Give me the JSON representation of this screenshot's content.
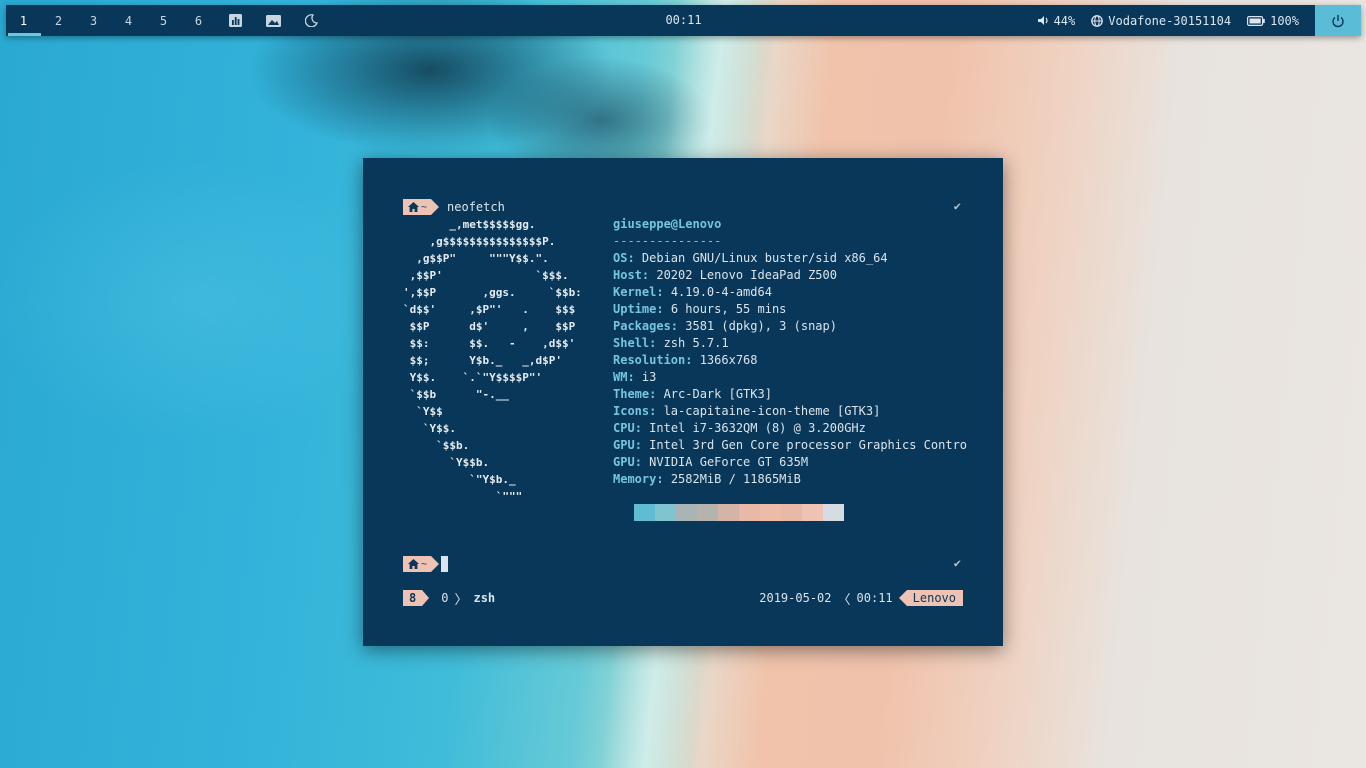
{
  "topbar": {
    "workspaces": [
      "1",
      "2",
      "3",
      "4",
      "5",
      "6"
    ],
    "active_workspace": "1",
    "clock": "00:11",
    "volume": "44%",
    "network": "Vodafone-30151104",
    "battery": "100%",
    "icons": [
      "chart-icon",
      "image-icon",
      "moon-icon",
      "volume-icon",
      "globe-icon",
      "battery-icon",
      "power-icon"
    ]
  },
  "terminal": {
    "home_glyph": "~",
    "command": "neofetch",
    "ascii_art": "       _,met$$$$$gg.\n    ,g$$$$$$$$$$$$$$$P.\n  ,g$$P\"     \"\"\"Y$$.\".\n ,$$P'              `$$$.\n',$$P       ,ggs.     `$$b:\n`d$$'     ,$P\"'   .    $$$\n $$P      d$'     ,    $$P\n $$:      $$.   -    ,d$$'\n $$;      Y$b._   _,d$P'\n Y$$.    `.`\"Y$$$$P\"'\n `$$b      \"-.__\n  `Y$$\n   `Y$$.\n     `$$b.\n       `Y$$b.\n          `\"Y$b._\n              `\"\"\"",
    "userhost": "giuseppe@Lenovo",
    "separator": "---------------",
    "info": [
      {
        "key": "OS",
        "value": "Debian GNU/Linux buster/sid x86_64"
      },
      {
        "key": "Host",
        "value": "20202 Lenovo IdeaPad Z500"
      },
      {
        "key": "Kernel",
        "value": "4.19.0-4-amd64"
      },
      {
        "key": "Uptime",
        "value": "6 hours, 55 mins"
      },
      {
        "key": "Packages",
        "value": "3581 (dpkg), 3 (snap)"
      },
      {
        "key": "Shell",
        "value": "zsh 5.7.1"
      },
      {
        "key": "Resolution",
        "value": "1366x768"
      },
      {
        "key": "WM",
        "value": "i3"
      },
      {
        "key": "Theme",
        "value": "Arc-Dark [GTK3]"
      },
      {
        "key": "Icons",
        "value": "la-capitaine-icon-theme [GTK3]"
      },
      {
        "key": "CPU",
        "value": "Intel i7-3632QM (8) @ 3.200GHz"
      },
      {
        "key": "GPU",
        "value": "Intel 3rd Gen Core processor Graphics Contro"
      },
      {
        "key": "GPU",
        "value": "NVIDIA GeForce GT 635M"
      },
      {
        "key": "Memory",
        "value": "2582MiB / 11865MiB"
      }
    ],
    "swatch_colors": [
      "#5fbcd3",
      "#7fc4cf",
      "#a9b4b4",
      "#b6b2ae",
      "#d4b4a6",
      "#e7b9a6",
      "#ecbca8",
      "#e9b9a7",
      "#efc3b4",
      "#d6dce1"
    ],
    "statusline": {
      "session_count": "8",
      "window_index": "0",
      "window_name": "zsh",
      "date": "2019-05-02",
      "time": "00:11",
      "host": "Lenovo"
    }
  }
}
